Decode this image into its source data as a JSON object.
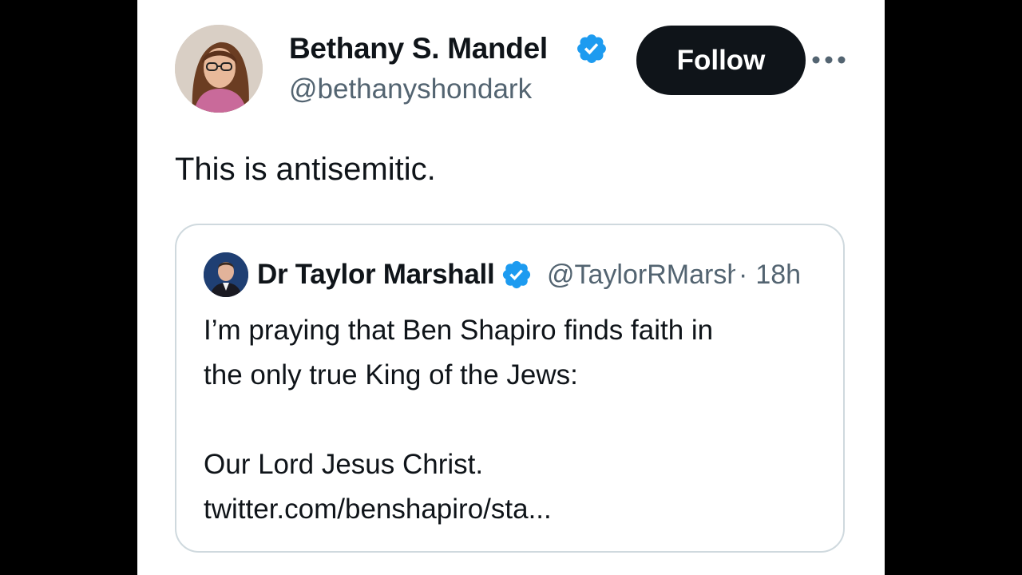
{
  "tweet": {
    "author": {
      "display_name": "Bethany S. Mandel",
      "handle": "@bethanyshondark",
      "verified": true,
      "avatar_icon": "user-avatar"
    },
    "follow_label": "Follow",
    "more_icon": "more-horizontal-icon",
    "text": "This is antisemitic."
  },
  "quoted_tweet": {
    "author": {
      "display_name": "Dr Taylor Marshall",
      "handle": "@TaylorRMarshall",
      "verified": true,
      "avatar_icon": "user-avatar"
    },
    "separator": "·",
    "time": "18h",
    "lines": [
      "I’m praying that Ben Shapiro finds faith in",
      "the only true King of the Jews:",
      "",
      "Our Lord Jesus Christ.",
      "twitter.com/benshapiro/sta..."
    ]
  },
  "colors": {
    "text_primary": "#0f1419",
    "text_secondary": "#536471",
    "verified_blue": "#1d9bf0",
    "button_bg": "#0f1419",
    "border": "#cfd9de"
  }
}
